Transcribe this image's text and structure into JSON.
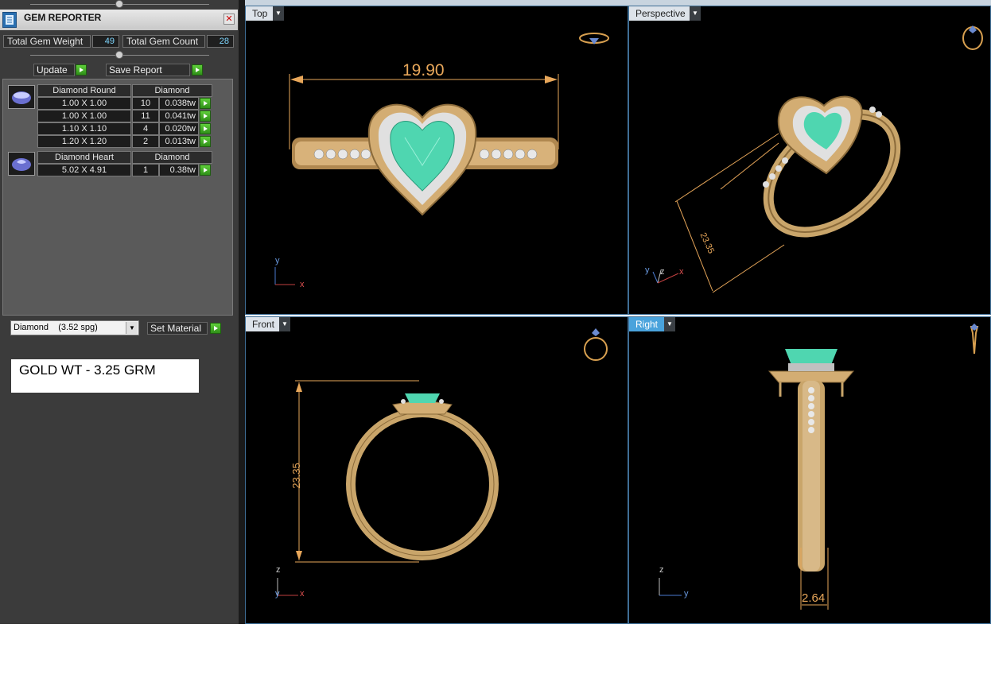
{
  "panel": {
    "title": "GEM REPORTER",
    "total_weight_label": "Total Gem Weight",
    "total_weight_value": "49",
    "total_count_label": "Total Gem Count",
    "total_count_value": "28",
    "update_label": "Update",
    "save_report_label": "Save Report",
    "groups": [
      {
        "name": "Diamond Round",
        "material": "Diamond",
        "rows": [
          {
            "size": "1.00 X 1.00",
            "count": "10",
            "weight": "0.038tw"
          },
          {
            "size": "1.00 X 1.00",
            "count": "11",
            "weight": "0.041tw"
          },
          {
            "size": "1.10 X 1.10",
            "count": "4",
            "weight": "0.020tw"
          },
          {
            "size": "1.20 X 1.20",
            "count": "2",
            "weight": "0.013tw"
          }
        ]
      },
      {
        "name": "Diamond Heart",
        "material": "Diamond",
        "rows": [
          {
            "size": "5.02 X 4.91",
            "count": "1",
            "weight": "0.38tw"
          }
        ]
      }
    ],
    "material_select": "Diamond    (3.52 spg)",
    "set_material_label": "Set Material",
    "gold_weight": "GOLD WT - 3.25 GRM"
  },
  "viewports": {
    "top": {
      "label": "Top",
      "dimension": "19.90"
    },
    "perspective": {
      "label": "Perspective",
      "dimension": "23.35"
    },
    "front": {
      "label": "Front",
      "dimension": "23.35"
    },
    "right": {
      "label": "Right",
      "dimension": "2.64"
    }
  },
  "axes": {
    "x": "x",
    "y": "y",
    "z": "z"
  },
  "colors": {
    "gold": "#c9a56a",
    "gold_dark": "#8a6a3a",
    "gem": "#4fd6b0",
    "dimension": "#e8a75a",
    "viewport_bg": "#000000",
    "active_tab": "#4aa3dc"
  }
}
